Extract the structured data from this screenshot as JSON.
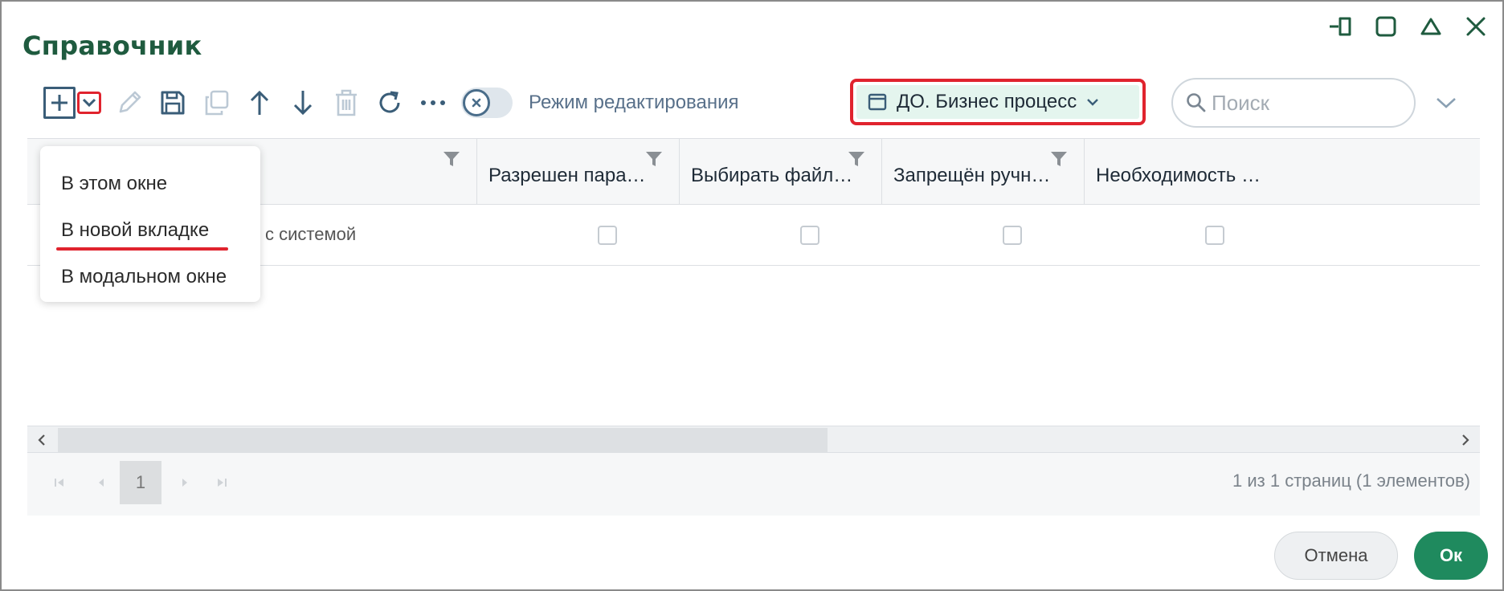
{
  "dialog": {
    "title": "Справочник"
  },
  "window_controls": [
    "minimize-to-tray-icon",
    "maximize-icon",
    "collapse-icon",
    "close-icon"
  ],
  "toolbar": {
    "icons": [
      "add-icon",
      "chevron-down-icon",
      "edit-icon",
      "save-icon",
      "copy-icon",
      "arrow-up-icon",
      "arrow-down-icon",
      "trash-icon",
      "refresh-icon",
      "more-icon"
    ],
    "edit_mode_label": "Режим редактирования"
  },
  "process_selector": {
    "label": "ДО. Бизнес процесс"
  },
  "search": {
    "placeholder": "Поиск"
  },
  "grid": {
    "columns": [
      {
        "label": ""
      },
      {
        "label": "Разрешен пара…"
      },
      {
        "label": "Выбирать файл…"
      },
      {
        "label": "Запрещён ручн…"
      },
      {
        "label": "Необходимость …"
      }
    ],
    "rows": [
      {
        "text": "с системой",
        "checks": [
          false,
          false,
          false,
          false
        ]
      }
    ]
  },
  "pager": {
    "current_page": "1",
    "info": "1 из 1 страниц (1 элементов)"
  },
  "footer": {
    "cancel_label": "Отмена",
    "ok_label": "Ок"
  },
  "dropdown_menu": {
    "items": [
      {
        "label": "В этом окне"
      },
      {
        "label": "В новой вкладке"
      },
      {
        "label": "В модальном окне"
      }
    ]
  },
  "colors": {
    "title": "#1f5b3f",
    "highlight": "#e0232e",
    "ok_button": "#1f8a5e",
    "selector_bg": "#e4f5ee"
  }
}
